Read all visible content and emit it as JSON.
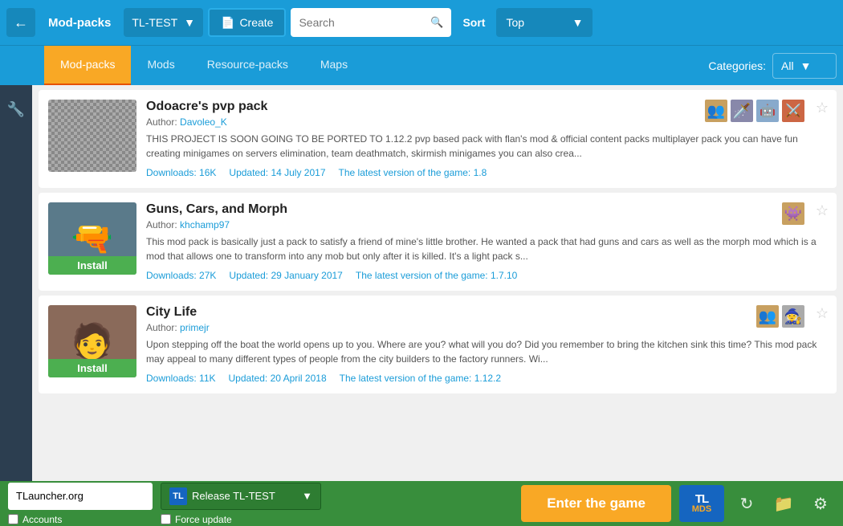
{
  "topbar": {
    "back_icon": "←",
    "modpacks_label": "Mod-packs",
    "version": "TL-TEST",
    "create_label": "Create",
    "search_placeholder": "Search",
    "sort_label": "Sort",
    "top_label": "Top"
  },
  "navbar": {
    "tabs": [
      {
        "id": "modpacks",
        "label": "Mod-packs",
        "active": true
      },
      {
        "id": "mods",
        "label": "Mods",
        "active": false
      },
      {
        "id": "resource-packs",
        "label": "Resource-packs",
        "active": false
      },
      {
        "id": "maps",
        "label": "Maps",
        "active": false
      }
    ],
    "categories_label": "Categories:",
    "categories_value": "All"
  },
  "packs": [
    {
      "id": "odoacre",
      "title": "Odoacre's pvp pack",
      "author": "Davoleo_K",
      "description": "THIS PROJECT IS SOON GOING TO BE PORTED TO 1.12.2 pvp based pack with flan's mod & official content packs multiplayer pack you can have fun creating minigames on servers elimination, team deathmatch, skirmish minigames you can also crea...",
      "downloads": "16K",
      "updated": "14 July 2017",
      "game_version": "1.8",
      "has_install": false,
      "thumb_class": "thumb-pvp"
    },
    {
      "id": "guns-cars-morph",
      "title": "Guns, Cars, and Morph",
      "author": "khchamp97",
      "description": "This mod pack is basically just a pack to satisfy a friend of mine's little brother. He wanted a pack that had guns and cars as well as the morph mod which is a mod that allows one to transform into any mob but only after it is killed. It's a light pack s...",
      "downloads": "27K",
      "updated": "29 January 2017",
      "game_version": "1.7.10",
      "has_install": true,
      "thumb_class": "thumb-guns"
    },
    {
      "id": "city-life",
      "title": "City Life",
      "author": "primejr",
      "description": "Upon stepping off the boat the world opens up to you. Where are you? what will you do? Did you remember to bring the kitchen sink this time? This mod pack may appeal to many different types of people from the city builders to the factory runners. Wi...",
      "downloads": "11K",
      "updated": "20 April 2018",
      "game_version": "1.12.2",
      "has_install": true,
      "thumb_class": "thumb-city"
    }
  ],
  "bottombar": {
    "url": "TLauncher.org",
    "release_icon": "TL",
    "release_label": "Release TL-TEST",
    "enter_game_label": "Enter the game",
    "logo_text": "TL",
    "logo_sub": "MDS",
    "accounts_label": "Accounts",
    "force_update_label": "Force update"
  },
  "icons": {
    "back": "←",
    "search": "🔍",
    "chevron_down": "▼",
    "star": "☆",
    "star_filled": "★",
    "wrench": "🔧",
    "refresh": "↻",
    "folder": "📁",
    "settings": "⚙"
  }
}
